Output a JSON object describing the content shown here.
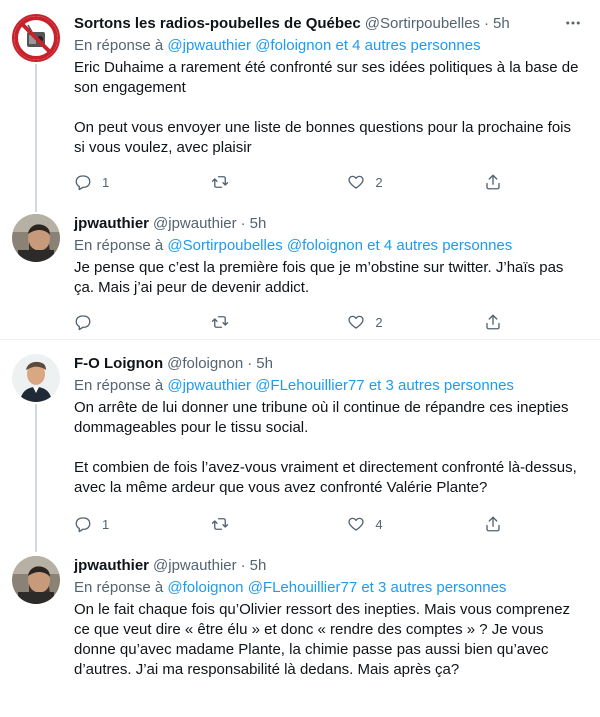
{
  "reply_prefix": "En réponse à",
  "tweets": [
    {
      "name": "Sortons les radios-poubelles de Québec",
      "handle": "@Sortirpoubelles",
      "dot": "·",
      "time": "5h",
      "reply_mentions": [
        "@jpwauthier",
        "@foloignon"
      ],
      "reply_others": "et 4 autres personnes",
      "paragraphs": [
        "Eric Duhaime a rarement été confronté sur ses idées politiques à la base de son engagement",
        "On peut vous envoyer une liste de bonnes questions pour la prochaine fois si vous voulez, avec plaisir"
      ],
      "replies": "1",
      "retweets": "",
      "likes": "2"
    },
    {
      "name": "jpwauthier",
      "handle": "@jpwauthier",
      "dot": "·",
      "time": "5h",
      "reply_mentions": [
        "@Sortirpoubelles",
        "@foloignon"
      ],
      "reply_others": "et 4 autres personnes",
      "paragraphs": [
        "Je pense que c’est la première fois que je m’obstine sur twitter. J’haïs pas ça. Mais j’ai peur de devenir addict."
      ],
      "replies": "",
      "retweets": "",
      "likes": "2"
    },
    {
      "name": "F-O Loignon",
      "handle": "@foloignon",
      "dot": "·",
      "time": "5h",
      "reply_mentions": [
        "@jpwauthier",
        "@FLehouillier77"
      ],
      "reply_others": "et 3 autres personnes",
      "paragraphs": [
        "On arrête de lui donner une tribune où il continue de répandre ces inepties dommageables pour le tissu social.",
        "Et combien de fois l’avez-vous vraiment et directement confronté là-dessus, avec la même ardeur que vous avez confronté Valérie Plante?"
      ],
      "replies": "1",
      "retweets": "",
      "likes": "4"
    },
    {
      "name": "jpwauthier",
      "handle": "@jpwauthier",
      "dot": "·",
      "time": "5h",
      "reply_mentions": [
        "@foloignon",
        "@FLehouillier77"
      ],
      "reply_others": "et 3 autres personnes",
      "paragraphs": [
        "On le fait chaque fois qu’Olivier ressort des inepties. Mais vous comprenez ce que veut dire « être élu » et donc « rendre des comptes » ? Je vous donne qu’avec madame Plante, la chimie passe pas aussi bien qu’avec d’autres. J’ai ma responsabilité là dedans. Mais après ça?"
      ]
    }
  ],
  "colors": {
    "link": "#1d9bf0",
    "secondary": "#536471",
    "text": "#0f1419",
    "thread": "#cfd9de"
  },
  "icons": [
    "more-icon",
    "reply-icon",
    "retweet-icon",
    "like-icon",
    "share-icon"
  ]
}
